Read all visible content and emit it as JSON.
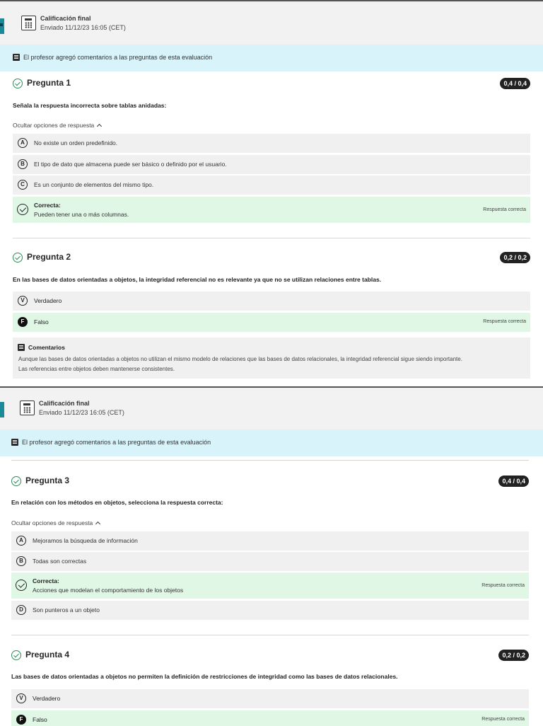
{
  "header": {
    "title": "Calificación final",
    "subtitle": "Enviado 11/12/23 16:05 (CET)"
  },
  "banner": {
    "text": "El profesor agregó comentarios a las preguntas de esta evaluación"
  },
  "common": {
    "hide_options_label": "Ocultar opciones de respuesta",
    "correct_label": "Correcta:",
    "correct_answer_label": "Respuesta correcta",
    "comments_label": "Comentarios"
  },
  "questions": [
    {
      "title": "Pregunta 1",
      "score": "0,4 / 0,4",
      "text": "Señala la respuesta incorrecta sobre tablas anidadas:",
      "options": [
        {
          "letter": "A",
          "text": "No existe un orden predefinido."
        },
        {
          "letter": "B",
          "text": "El tipo de dato que almacena puede ser básico o definido por el usuario."
        },
        {
          "letter": "C",
          "text": "Es un conjunto de elementos del mismo tipo."
        },
        {
          "letter": "",
          "text": "Pueden tener una o más columnas."
        }
      ]
    },
    {
      "title": "Pregunta 2",
      "score": "0,2 / 0,2",
      "text": "En las bases de datos orientadas a objetos, la integridad referencial no es relevante ya que no se utilizan relaciones entre tablas.",
      "options": [
        {
          "letter": "V",
          "text": "Verdadero"
        },
        {
          "letter": "F",
          "text": "Falso"
        }
      ],
      "comment": [
        "Aunque las bases de datos orientadas a objetos no utilizan el mismo modelo de relaciones que las bases de datos relacionales, la integridad referencial sigue siendo importante.",
        "Las referencias entre objetos deben mantenerse consistentes."
      ]
    },
    {
      "title": "Pregunta 3",
      "score": "0,4 / 0,4",
      "text": "En relación con los métodos en objetos, selecciona la respuesta correcta:",
      "options": [
        {
          "letter": "A",
          "text": "Mejoramos la búsqueda de información"
        },
        {
          "letter": "B",
          "text": "Todas son correctas"
        },
        {
          "letter": "",
          "text": "Acciones que modelan el comportamiento de los objetos"
        },
        {
          "letter": "D",
          "text": "Son punteros a un objeto"
        }
      ]
    },
    {
      "title": "Pregunta 4",
      "score": "0,2 / 0,2",
      "text": "Las bases de datos orientadas a objetos no permiten la definición de restricciones de integridad como las bases de datos relacionales.",
      "options": [
        {
          "letter": "V",
          "text": "Verdadero"
        },
        {
          "letter": "F",
          "text": "Falso"
        }
      ]
    }
  ],
  "colors": {
    "banner_bg": "#d9f3fb",
    "correct_bg": "#e0f7e6",
    "option_bg": "#f0f0f0",
    "check_green": "#2e8b57",
    "teal_accent": "#1a8a99"
  }
}
